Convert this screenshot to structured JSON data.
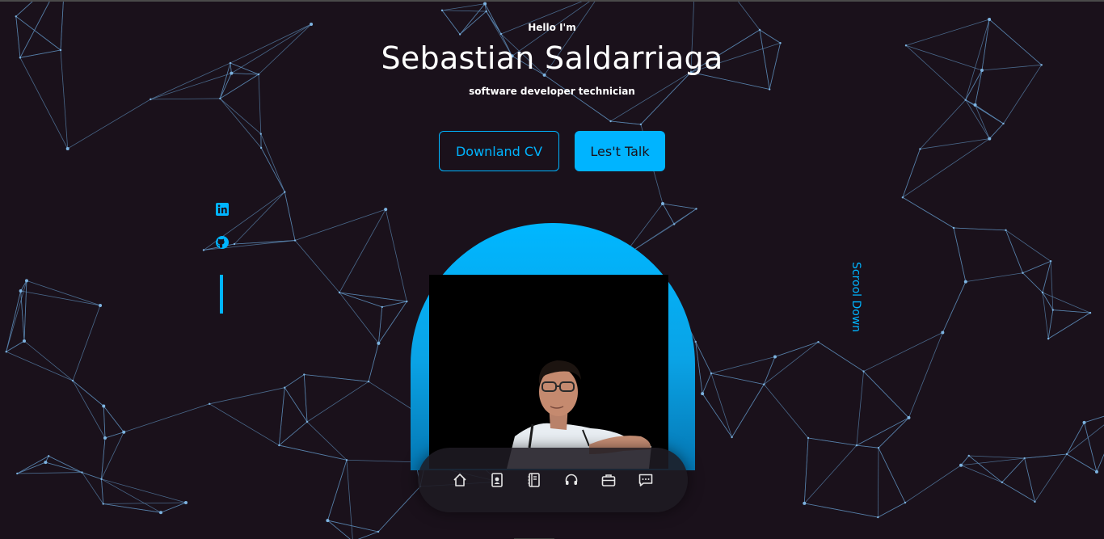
{
  "hero": {
    "greeting": "Hello I'm",
    "name": "Sebastian Saldarriaga",
    "role": "software developer technician"
  },
  "buttons": {
    "cv_label": "Downland CV",
    "talk_label": "Les't Talk"
  },
  "socials": [
    {
      "icon": "linkedin-icon"
    },
    {
      "icon": "github-icon"
    }
  ],
  "scroll_label": "Scrool Down",
  "nav": [
    {
      "icon": "home-icon"
    },
    {
      "icon": "about-icon"
    },
    {
      "icon": "book-icon"
    },
    {
      "icon": "headset-icon"
    },
    {
      "icon": "briefcase-icon"
    },
    {
      "icon": "message-icon"
    }
  ],
  "colors": {
    "background": "#1a111b",
    "accent": "#00b4ff",
    "text": "#ffffff",
    "network_lines": "#5a86b0"
  }
}
